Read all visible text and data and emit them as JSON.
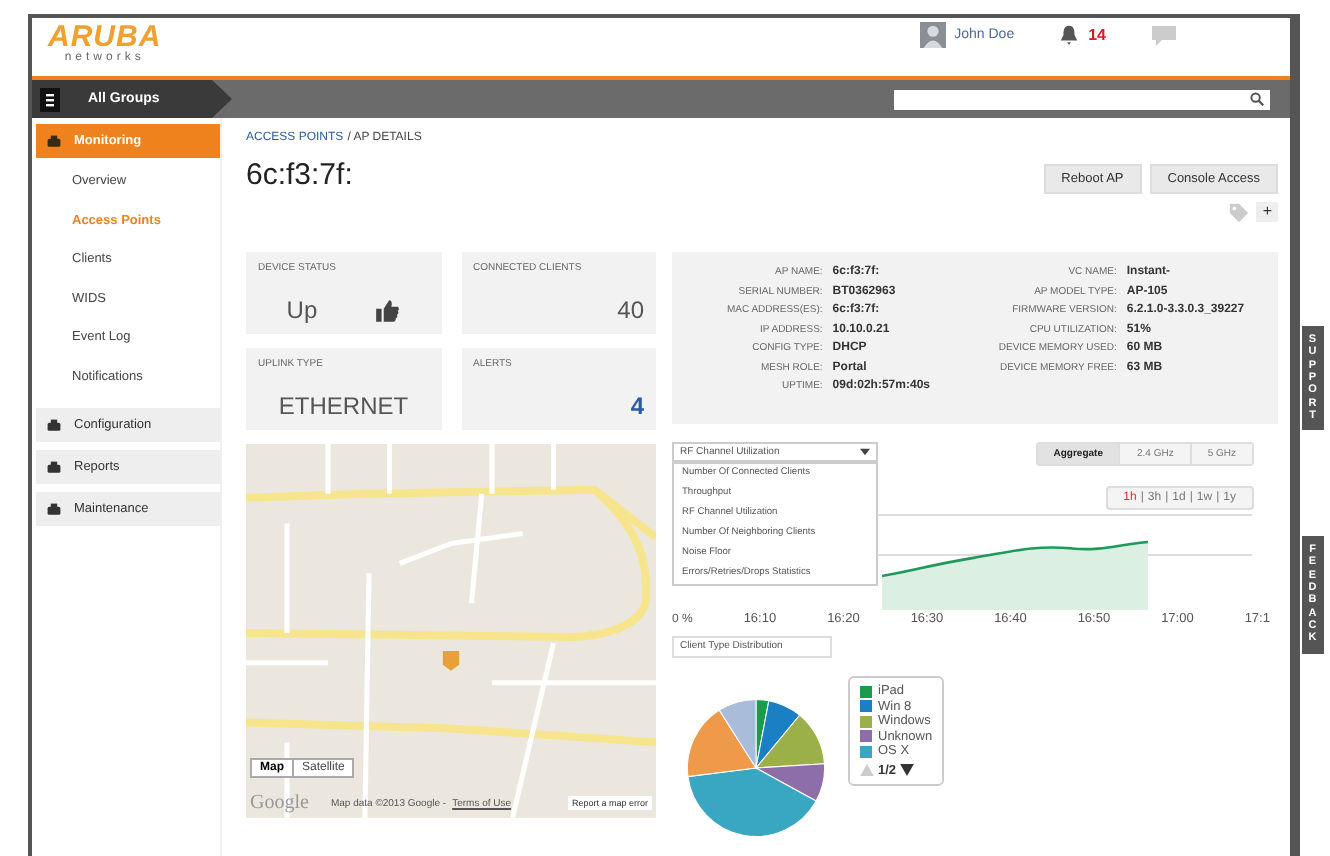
{
  "header": {
    "logo": "ARUBA",
    "logo_sub": "networks",
    "user": "John Doe",
    "alerts": "14"
  },
  "nav": {
    "group": "All Groups"
  },
  "sidebar": {
    "sections": [
      {
        "label": "Monitoring",
        "selected": true,
        "children": [
          {
            "label": "Overview",
            "selected": false
          },
          {
            "label": "Access Points",
            "selected": true
          },
          {
            "label": "Clients",
            "selected": false
          },
          {
            "label": "WIDS",
            "selected": false
          },
          {
            "label": "Event Log",
            "selected": false
          },
          {
            "label": "Notifications",
            "selected": false
          }
        ]
      },
      {
        "label": "Configuration",
        "selected": false
      },
      {
        "label": "Reports",
        "selected": false
      },
      {
        "label": "Maintenance",
        "selected": false
      }
    ]
  },
  "breadcrumb": {
    "link": "ACCESS POINTS",
    "current": "/ AP DETAILS"
  },
  "title": "6c:f3:7f:",
  "actions": [
    "Reboot AP",
    "Console Access"
  ],
  "add_tag": "+",
  "tiles": [
    {
      "label": "DEVICE STATUS",
      "value": "Up",
      "kind": "status"
    },
    {
      "label": "CONNECTED CLIENTS",
      "value": "40",
      "kind": "number"
    },
    {
      "label": "UPLINK TYPE",
      "value": "ETHERNET",
      "kind": "text"
    },
    {
      "label": "ALERTS",
      "value": "4",
      "kind": "alert"
    }
  ],
  "details": {
    "left": [
      {
        "key": "AP NAME:",
        "value": "6c:f3:7f:"
      },
      {
        "key": "SERIAL NUMBER:",
        "value": "BT0362963"
      },
      {
        "key": "MAC ADDRESS(ES):",
        "value": "6c:f3:7f:"
      },
      {
        "key": "IP ADDRESS:",
        "value": "10.10.0.21"
      },
      {
        "key": "CONFIG TYPE:",
        "value": "DHCP"
      },
      {
        "key": "MESH ROLE:",
        "value": "Portal"
      },
      {
        "key": "UPTIME:",
        "value": "09d:02h:57m:40s"
      }
    ],
    "right": [
      {
        "key": "VC NAME:",
        "value": "Instant-"
      },
      {
        "key": "AP MODEL TYPE:",
        "value": "AP-105"
      },
      {
        "key": "FIRMWARE VERSION:",
        "value": "6.2.1.0-3.3.0.3_39227"
      },
      {
        "key": "CPU UTILIZATION:",
        "value": "51%"
      },
      {
        "key": "DEVICE MEMORY USED:",
        "value": "60 MB"
      },
      {
        "key": "DEVICE MEMORY FREE:",
        "value": "63 MB"
      }
    ]
  },
  "chart": {
    "metric": {
      "value": "RF Channel Utilization",
      "expanded": true,
      "options": [
        "Number Of Connected Clients",
        "Throughput",
        "RF Channel Utilization",
        "Number Of Neighboring Clients",
        "Noise Floor",
        "Errors/Retries/Drops Statistics"
      ]
    },
    "bands": [
      {
        "label": "Aggregate",
        "selected": true
      },
      {
        "label": "2.4 GHz",
        "selected": false
      },
      {
        "label": "5 GHz",
        "selected": false
      }
    ],
    "ranges": [
      {
        "label": "1h",
        "selected": true
      },
      {
        "label": "3h",
        "selected": false
      },
      {
        "label": "1d",
        "selected": false
      },
      {
        "label": "1w",
        "selected": false
      },
      {
        "label": "1y",
        "selected": false
      }
    ],
    "range_separator": "|",
    "y_label": "0 %",
    "x_labels": [
      "16:10",
      "16:20",
      "16:30",
      "16:40",
      "16:50",
      "17:00",
      "17:1"
    ]
  },
  "distribution": {
    "select": "Client Type Distribution",
    "legend": [
      {
        "label": "iPad",
        "color": "#1a9c4c"
      },
      {
        "label": "Win 8",
        "color": "#1b7fc4"
      },
      {
        "label": "Windows",
        "color": "#9cb04a"
      },
      {
        "label": "Unknown",
        "color": "#8e6ea8"
      },
      {
        "label": "OS X",
        "color": "#3aa7c2"
      }
    ],
    "pager": "1/2"
  },
  "map": {
    "buttons": [
      {
        "label": "Map",
        "selected": true
      },
      {
        "label": "Satellite",
        "selected": false
      }
    ],
    "brand": "Google",
    "attribution": "Map data ©2013 Google -",
    "terms": "Terms of Use",
    "report": "Report a map error"
  },
  "side_tabs": [
    "SUPPORT",
    "FEEDBACK"
  ]
}
